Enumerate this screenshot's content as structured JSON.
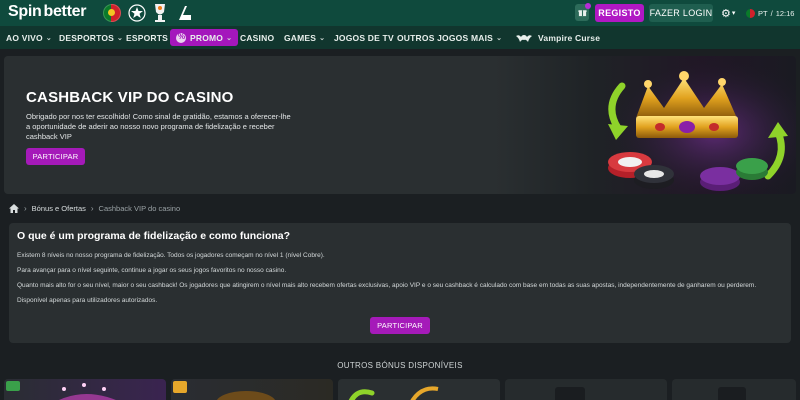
{
  "header": {
    "logo": {
      "part1": "Spin",
      "part2": "better"
    },
    "register_label": "REGISTO",
    "login_label": "FAZER LOGIN",
    "language": "PT",
    "time": "12:16",
    "icons": [
      "portugal-flag-icon",
      "champions-league-icon",
      "europa-league-icon",
      "ufc-icon",
      "gift-icon",
      "settings-icon"
    ]
  },
  "nav": {
    "items": [
      {
        "label": "AO VIVO",
        "dropdown": true
      },
      {
        "label": "DESPORTOS",
        "dropdown": true
      },
      {
        "label": "ESPORTS",
        "dropdown": false
      },
      {
        "label": "PROMO",
        "dropdown": true,
        "active": true
      },
      {
        "label": "CASINO",
        "dropdown": false
      },
      {
        "label": "GAMES",
        "dropdown": true
      },
      {
        "label": "JOGOS DE TV",
        "dropdown": false
      },
      {
        "label": "OUTROS JOGOS",
        "dropdown": false
      },
      {
        "label": "MAIS",
        "dropdown": true
      },
      {
        "label": "Vampire Curse",
        "dropdown": false
      }
    ]
  },
  "banner": {
    "title": "CASHBACK VIP DO CASINO",
    "text": "Obrigado por nos ter escolhido! Como sinal de gratidão, estamos a oferecer-lhe a oportunidade de aderir ao nosso novo programa de fidelização e receber cashback VIP",
    "button": "PARTICIPAR"
  },
  "breadcrumb": {
    "items": [
      "Bónus e Ofertas",
      "Cashback VIP do casino"
    ]
  },
  "info": {
    "title": "O que é um programa de fidelização e como funciona?",
    "paragraphs": [
      "Existem 8 níveis no nosso programa de fidelização. Todos os jogadores começam no nível 1 (nível Cobre).",
      "Para avançar para o nível seguinte, continue a jogar os seus jogos favoritos no nosso casino.",
      "Quanto mais alto for o seu nível, maior o seu cashback! Os jogadores que atingirem o nível mais alto recebem ofertas exclusivas, apoio VIP e o seu cashback é calculado com base em todas as suas apostas, independentemente de ganharem ou perderem.",
      "Disponível apenas para utilizadores autorizados."
    ],
    "button": "PARTICIPAR"
  },
  "others": {
    "title": "OUTROS BÓNUS DISPONÍVEIS"
  },
  "colors": {
    "topbar": "#0f4a3d",
    "nav": "#11362e",
    "accent": "#a51ab9",
    "panel": "#2a2f31",
    "background": "#1b1f22"
  }
}
